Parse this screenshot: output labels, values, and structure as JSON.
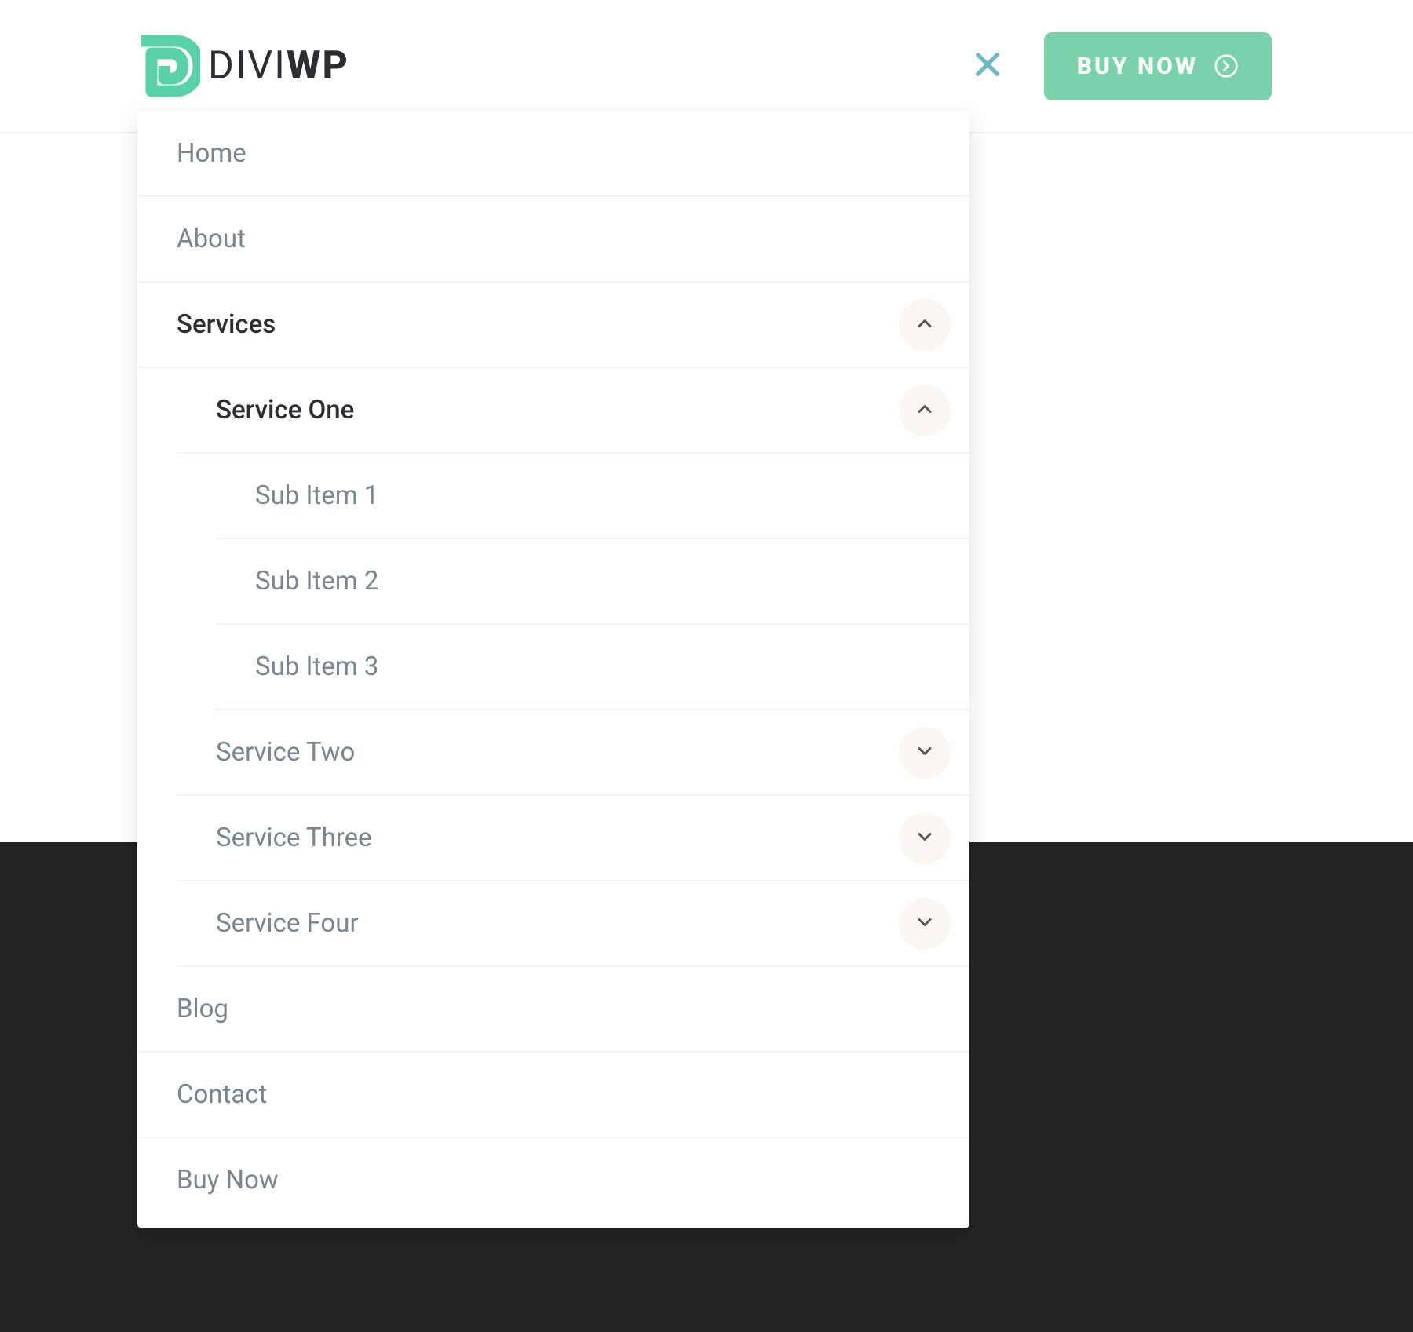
{
  "logo": {
    "brand": "DIVI",
    "brand_bold": "WP"
  },
  "header": {
    "buy_now": "BUY NOW"
  },
  "menu": {
    "home": "Home",
    "about": "About",
    "services": "Services",
    "service_one": "Service One",
    "sub1": "Sub Item 1",
    "sub2": "Sub Item 2",
    "sub3": "Sub Item 3",
    "service_two": "Service Two",
    "service_three": "Service Three",
    "service_four": "Service Four",
    "blog": "Blog",
    "contact": "Contact",
    "buy_now": "Buy Now"
  }
}
